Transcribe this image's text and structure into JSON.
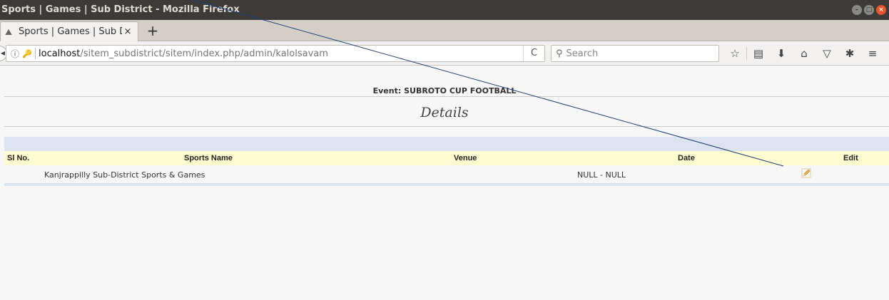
{
  "window": {
    "title": "Sports | Games | Sub District - Mozilla Firefox"
  },
  "tab": {
    "title": "Sports | Games | Sub Di",
    "close": "×",
    "new_tab": "+"
  },
  "urlbar": {
    "host": "localhost",
    "path": "/sitem_subdistrict/sitem/index.php/admin/kalolsavam",
    "reload": "C"
  },
  "search": {
    "placeholder": "Search"
  },
  "page": {
    "event": "Event: SUBROTO CUP FOOTBALL",
    "heading": "Details",
    "columns": [
      "Sl No.",
      "Sports Name",
      "Venue",
      "Date",
      "Edit"
    ],
    "rows": [
      {
        "sports_name": "Kanjrappilly Sub-District Sports & Games",
        "venue": "",
        "date": "NULL - NULL"
      }
    ]
  },
  "colors": {
    "titlebar": "#3c3b37",
    "header_row": "#fffcd0",
    "band": "#dde3ef",
    "overlay_line": "#1f3f77"
  }
}
